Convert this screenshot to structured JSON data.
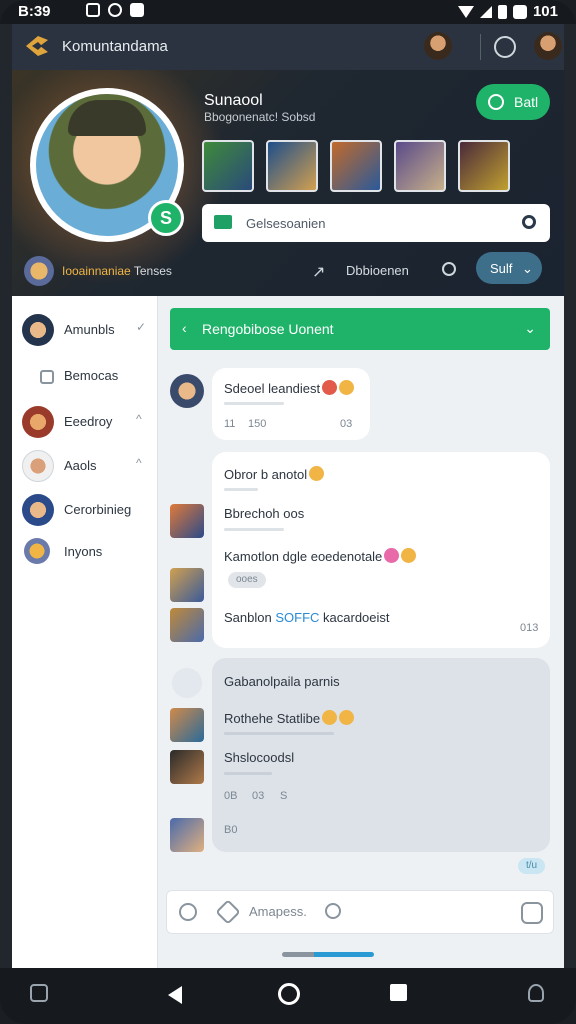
{
  "status_bar": {
    "time": "B:39",
    "battery": "101"
  },
  "header": {
    "title": "Komuntandama"
  },
  "profile": {
    "name": "Sunaool",
    "subtitle": "Bbogonenatc! Sobsd",
    "chat_button": "Batl",
    "search_placeholder": "Gelsesoanien",
    "community_label": "Iooainnaniae",
    "community_label_suffix": "Tenses",
    "breadcrumb": "Dbbioenen",
    "stats_button": "Sulf"
  },
  "sidebar": {
    "items": [
      {
        "label": "Amunbls",
        "chevron": "✓"
      },
      {
        "label": "Bemocas",
        "chevron": ""
      },
      {
        "label": "Eeedroy",
        "chevron": "^"
      },
      {
        "label": "Aaols",
        "chevron": "^"
      },
      {
        "label": "Cerorbinieg",
        "chevron": ""
      },
      {
        "label": "Inyons",
        "chevron": ""
      }
    ]
  },
  "chat": {
    "group_title": "Rengobibose Uonent",
    "messages": [
      {
        "text": "Sdeoel leandiest",
        "meta_left": "11",
        "meta_mid": "150",
        "meta_time": "03"
      },
      {
        "text": "Obror b anotol"
      },
      {
        "text": "Bbrechoh oos"
      },
      {
        "text": "Kamotlon dgle eoedenotale"
      },
      {
        "tag": "ooes"
      },
      {
        "text_before": "Sanblon",
        "link": "SOFFC",
        "text_after": "kacardoeist",
        "time": "013"
      },
      {
        "text": "Gabanolpaila parnis"
      },
      {
        "text": "Rothehe Statlibe"
      },
      {
        "text": "Shslocoodsl"
      },
      {
        "meta_left": "0B",
        "meta_mid": "03",
        "meta_end": "S"
      },
      {
        "meta_left": "B0"
      }
    ],
    "badge": "t/u",
    "composer_placeholder": "Amapess."
  },
  "colors": {
    "accent": "#1fb36a",
    "header_bg": "#2a333f",
    "link": "#2a8ad4",
    "bubble_bg": "#ffffff",
    "main_bg": "#eef1f4"
  }
}
